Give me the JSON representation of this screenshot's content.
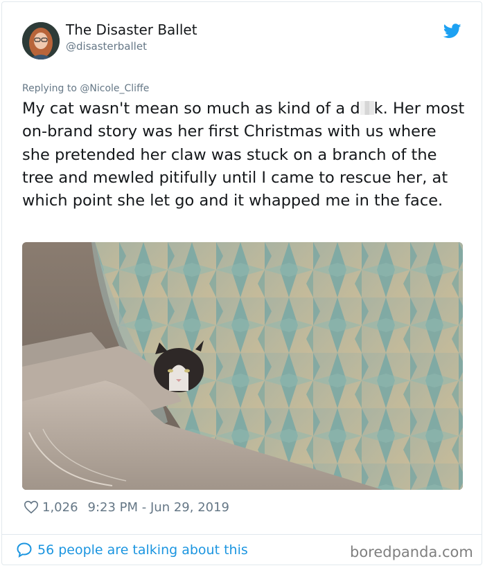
{
  "author": {
    "display_name": "The Disaster Ballet",
    "handle": "@disasterballet",
    "avatar_icon": "user-avatar",
    "brand_icon": "twitter-bird-icon"
  },
  "reply": {
    "prefix": "Replying to ",
    "mention": "@Nicole_Cliffe"
  },
  "tweet": {
    "text_before": "My cat wasn't  mean so much as kind of a d",
    "text_after": "k. Her most on-brand story was her first Christmas with us where she pretended her claw was stuck on a branch of the tree and mewled pitifully until I came to rescue her, at which point she let go and it whapped me in the face."
  },
  "media": {
    "icon": "cat-in-bathtub-photo"
  },
  "stats": {
    "likes": "1,026",
    "timestamp": "9:23 PM - Jun 29, 2019"
  },
  "footer": {
    "talking": "56 people are talking about this",
    "watermark": "boredpanda.com"
  },
  "colors": {
    "accent": "#1b95e0",
    "secondary_text": "#657786",
    "divider": "#e1e8ed"
  }
}
